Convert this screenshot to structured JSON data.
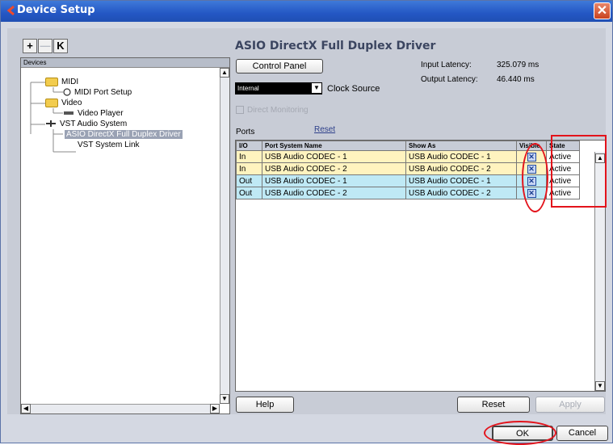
{
  "window": {
    "title": "Device Setup",
    "close_symbol": "✕"
  },
  "toolbar": {
    "add_symbol": "+",
    "remove_symbol": "—",
    "reset_symbol": "K"
  },
  "devices": {
    "header": "Devices",
    "items": [
      {
        "label": "MIDI",
        "icon": "folder-icon"
      },
      {
        "label": "MIDI Port Setup",
        "icon": "midi-port-icon"
      },
      {
        "label": "Video",
        "icon": "folder-icon"
      },
      {
        "label": "Video Player",
        "icon": "video-player-icon"
      },
      {
        "label": "VST Audio System",
        "icon": "audio-system-icon"
      },
      {
        "label": "ASIO DirectX Full Duplex Driver",
        "icon": "",
        "selected": true
      },
      {
        "label": "VST System Link",
        "icon": ""
      }
    ]
  },
  "driver": {
    "title": "ASIO DirectX Full Duplex Driver",
    "control_panel_label": "Control Panel",
    "input_latency_label": "Input Latency:",
    "input_latency_value": "325.079 ms",
    "output_latency_label": "Output Latency:",
    "output_latency_value": "46.440 ms",
    "clock_source_value": "Internal",
    "clock_source_label": "Clock Source",
    "direct_monitoring_label": "Direct Monitoring",
    "ports_label": "Ports",
    "reset_link": "Reset"
  },
  "ports_table": {
    "headers": [
      "I/O",
      "Port System Name",
      "Show As",
      "Visible",
      "State"
    ],
    "rows": [
      {
        "io": "In",
        "port": "USB Audio CODEC  - 1",
        "show_as": "USB Audio CODEC  - 1",
        "visible": "✕",
        "state": "Active"
      },
      {
        "io": "In",
        "port": "USB Audio CODEC  - 2",
        "show_as": "USB Audio CODEC  - 2",
        "visible": "✕",
        "state": "Active"
      },
      {
        "io": "Out",
        "port": "USB Audio CODEC  - 1",
        "show_as": "USB Audio CODEC  - 1",
        "visible": "✕",
        "state": "Active"
      },
      {
        "io": "Out",
        "port": "USB Audio CODEC  - 2",
        "show_as": "USB Audio CODEC  - 2",
        "visible": "✕",
        "state": "Active"
      }
    ]
  },
  "buttons": {
    "help": "Help",
    "reset": "Reset",
    "apply": "Apply",
    "ok": "OK",
    "cancel": "Cancel"
  },
  "colors": {
    "highlight": "#e3131b",
    "row_in": "#fff3bf",
    "row_out": "#bfe9f5",
    "titlebar": "#2457c4"
  }
}
